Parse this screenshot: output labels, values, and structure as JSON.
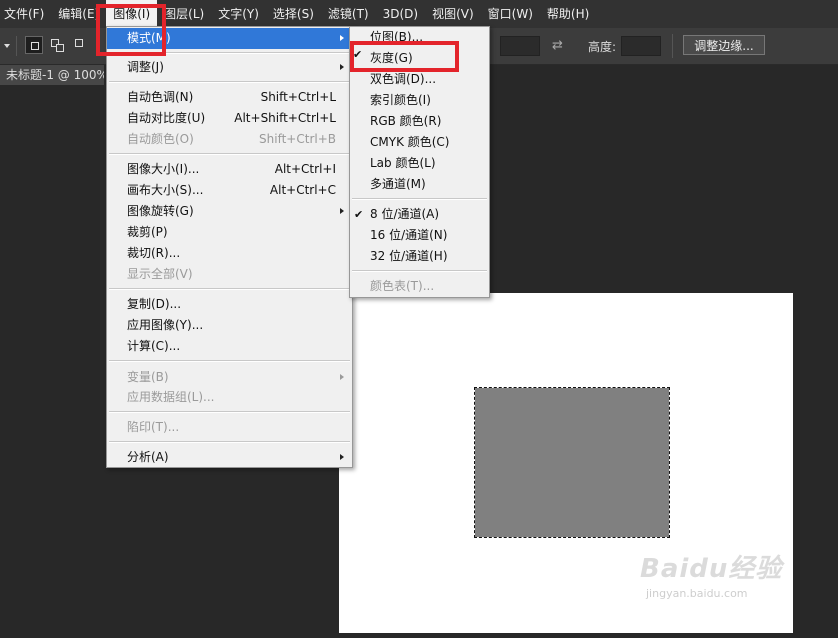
{
  "menubar": {
    "items": [
      "文件(F)",
      "编辑(E)",
      "图像(I)",
      "图层(L)",
      "文字(Y)",
      "选择(S)",
      "滤镜(T)",
      "3D(D)",
      "视图(V)",
      "窗口(W)",
      "帮助(H)"
    ]
  },
  "options_bar": {
    "height_label": "高度:",
    "refine_edge_label": "调整边缘...",
    "swap_icon": "swap-arrows-icon"
  },
  "document": {
    "tab_title": "未标题-1 @ 100%"
  },
  "image_menu": {
    "items": [
      {
        "label": "模式(M)",
        "shortcut": "",
        "submenu": true,
        "disabled": false
      },
      {
        "label": "调整(J)",
        "shortcut": "",
        "submenu": true,
        "disabled": false
      },
      {
        "label": "自动色调(N)",
        "shortcut": "Shift+Ctrl+L",
        "submenu": false,
        "disabled": false
      },
      {
        "label": "自动对比度(U)",
        "shortcut": "Alt+Shift+Ctrl+L",
        "submenu": false,
        "disabled": false
      },
      {
        "label": "自动颜色(O)",
        "shortcut": "Shift+Ctrl+B",
        "submenu": false,
        "disabled": true
      },
      {
        "label": "图像大小(I)...",
        "shortcut": "Alt+Ctrl+I",
        "submenu": false,
        "disabled": false
      },
      {
        "label": "画布大小(S)...",
        "shortcut": "Alt+Ctrl+C",
        "submenu": false,
        "disabled": false
      },
      {
        "label": "图像旋转(G)",
        "shortcut": "",
        "submenu": true,
        "disabled": false
      },
      {
        "label": "裁剪(P)",
        "shortcut": "",
        "submenu": false,
        "disabled": false
      },
      {
        "label": "裁切(R)...",
        "shortcut": "",
        "submenu": false,
        "disabled": false
      },
      {
        "label": "显示全部(V)",
        "shortcut": "",
        "submenu": false,
        "disabled": true
      },
      {
        "label": "复制(D)...",
        "shortcut": "",
        "submenu": false,
        "disabled": false
      },
      {
        "label": "应用图像(Y)...",
        "shortcut": "",
        "submenu": false,
        "disabled": false
      },
      {
        "label": "计算(C)...",
        "shortcut": "",
        "submenu": false,
        "disabled": false
      },
      {
        "label": "变量(B)",
        "shortcut": "",
        "submenu": true,
        "disabled": true
      },
      {
        "label": "应用数据组(L)...",
        "shortcut": "",
        "submenu": false,
        "disabled": true
      },
      {
        "label": "陷印(T)...",
        "shortcut": "",
        "submenu": false,
        "disabled": true
      },
      {
        "label": "分析(A)",
        "shortcut": "",
        "submenu": true,
        "disabled": false
      }
    ]
  },
  "mode_submenu": {
    "items": [
      {
        "label": "位图(B)...",
        "checked": false,
        "disabled": false
      },
      {
        "label": "灰度(G)",
        "checked": false,
        "disabled": false
      },
      {
        "label": "双色调(D)...",
        "checked": false,
        "disabled": false
      },
      {
        "label": "索引颜色(I)",
        "checked": false,
        "disabled": false
      },
      {
        "label": "RGB 颜色(R)",
        "checked": true,
        "disabled": false
      },
      {
        "label": "CMYK 颜色(C)",
        "checked": false,
        "disabled": false
      },
      {
        "label": "Lab 颜色(L)",
        "checked": false,
        "disabled": false
      },
      {
        "label": "多通道(M)",
        "checked": false,
        "disabled": false
      },
      {
        "label": "8 位/通道(A)",
        "checked": true,
        "disabled": false
      },
      {
        "label": "16 位/通道(N)",
        "checked": false,
        "disabled": false
      },
      {
        "label": "32 位/通道(H)",
        "checked": false,
        "disabled": false
      },
      {
        "label": "颜色表(T)...",
        "checked": false,
        "disabled": true
      }
    ]
  },
  "watermark": {
    "brand": "Baidu经验",
    "url": "jingyan.baidu.com"
  },
  "colors": {
    "highlight": "#3078d8",
    "annotation_red": "#e3242b",
    "canvas_fill": "#808080"
  }
}
